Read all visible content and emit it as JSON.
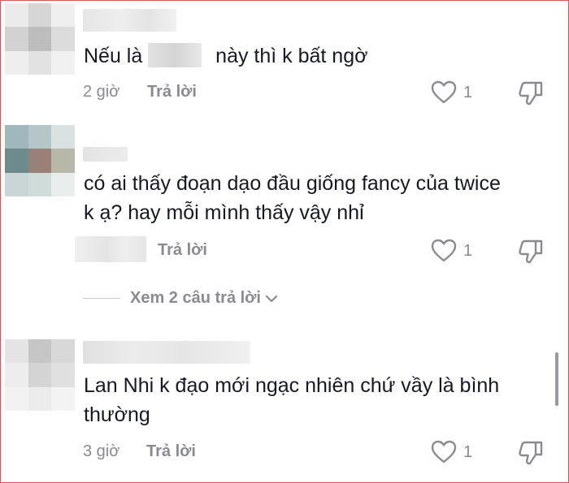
{
  "comments": [
    {
      "text_before": "Nếu là ",
      "text_after": " này thì k bất ngờ",
      "time": "2 giờ",
      "reply_label": "Trả lời",
      "like_count": "1"
    },
    {
      "text": "có ai thấy đoạn dạo đầu giống fancy của twice k ạ? hay mỗi mình thấy vậy nhỉ",
      "reply_label": "Trả lời",
      "like_count": "1"
    },
    {
      "text": "Lan Nhi k đạo mới ngạc nhiên chứ vầy là bình thường",
      "time": "3 giờ",
      "reply_label": "Trả lời",
      "like_count": "1"
    }
  ],
  "view_replies": {
    "label": "Xem 2 câu trả lời",
    "icon": "chevron-down-icon"
  },
  "icons": {
    "like": "heart-outline-icon",
    "dislike": "thumbs-down-outline-icon"
  },
  "colors": {
    "text": "#161823",
    "muted": "#8a8b91",
    "border": "#d9534f"
  }
}
